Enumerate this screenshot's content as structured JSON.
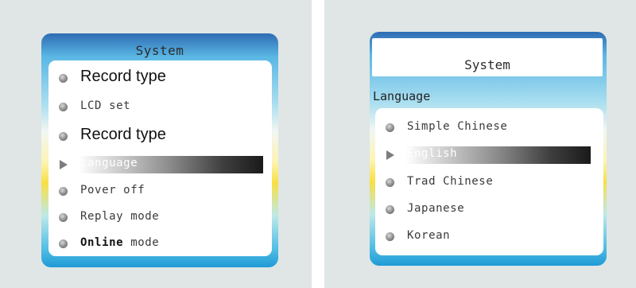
{
  "left_screen": {
    "title": "System",
    "items": [
      {
        "label": "Record type"
      },
      {
        "label": "LCD set"
      },
      {
        "label": "Record type"
      },
      {
        "label": "Language"
      },
      {
        "label": "Pover off"
      },
      {
        "label": "Replay mode"
      },
      {
        "label_bold": "Online",
        "label_rest": " mode"
      }
    ],
    "selected_index": 3
  },
  "right_screen": {
    "title": "System",
    "section": "Language",
    "items": [
      {
        "label": "Simple Chinese"
      },
      {
        "label": "English"
      },
      {
        "label": "Trad Chinese"
      },
      {
        "label": "Japanese"
      },
      {
        "label": "Korean"
      }
    ],
    "selected_index": 1
  },
  "icons": {
    "bullet": "bullet-dot-icon",
    "selected": "play-arrow-icon"
  },
  "colors": {
    "panel_background": "#dfe6e5",
    "screen_blue": "#2e6cb3",
    "screen_yellow": "#f7e044",
    "highlight_dark": "#1a1a1a"
  }
}
